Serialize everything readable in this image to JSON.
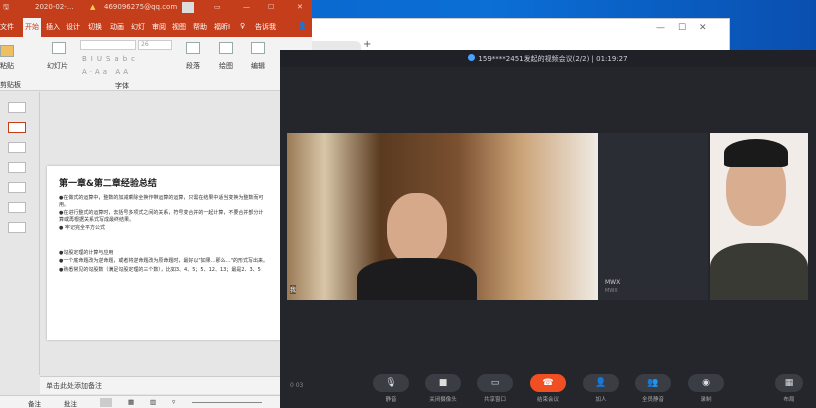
{
  "ppt": {
    "title": "2020-02-...",
    "account": "469096275@qq.com",
    "tabs": [
      "文件",
      "开始",
      "插入",
      "设计",
      "切换",
      "动画",
      "幻灯",
      "审阅",
      "视图",
      "帮助",
      "福昕I"
    ],
    "tell_me": "告诉我",
    "ribbon": {
      "paste": "粘贴",
      "clipboard": "剪贴板",
      "slides": "幻灯片",
      "font_size": "26",
      "font_group": "字体",
      "paragraph": "段落",
      "drawing": "绘图",
      "editing": "编辑"
    },
    "slide": {
      "title": "第一章&第二章经验总结",
      "bullets": [
        "●在做式的运算中，整数的加减乘除全换作带运算的运算，只需在结果中适当变换为整数而可用。",
        "●在进行整式的运算时，去括号多项式之间的关系，符号变合并的一起计算，不要合并部分计算或再根据关系式写成最终结果。",
        "● 牢记完全平方公式",
        "●勾股定理的计算与应用",
        "●一个底命题改为逆命题，或者将逆命题改为原命题时，最好以\"如果…那么…\"的形式写出来。",
        "●熟悉常见的勾股数（满足勾股定理的三个数），比如3、4、5；5、12、13；最是2、3、5"
      ]
    },
    "notes_placeholder": "单击此处添加备注",
    "status": {
      "notes": "备注",
      "comments": "批注",
      "zoom": "33"
    }
  },
  "meeting": {
    "title": "159****2451发起的视频会议(2/2) | 01:19:27",
    "participant_name": "MWX",
    "participant_sub": "MWX",
    "self_label": "我",
    "signal": "0 03",
    "toolbar": [
      {
        "icon": "microphone-icon",
        "label": "静音"
      },
      {
        "icon": "camera-icon",
        "label": "关闭摄像头"
      },
      {
        "icon": "screen-share-icon",
        "label": "共享窗口"
      },
      {
        "icon": "hangup-icon",
        "label": "结束会议"
      },
      {
        "icon": "add-person-icon",
        "label": "加人"
      },
      {
        "icon": "mute-all-icon",
        "label": "全员静音"
      },
      {
        "icon": "record-icon",
        "label": "录制"
      },
      {
        "icon": "layout-icon",
        "label": "布局"
      }
    ],
    "end_color": "#f04e23"
  }
}
